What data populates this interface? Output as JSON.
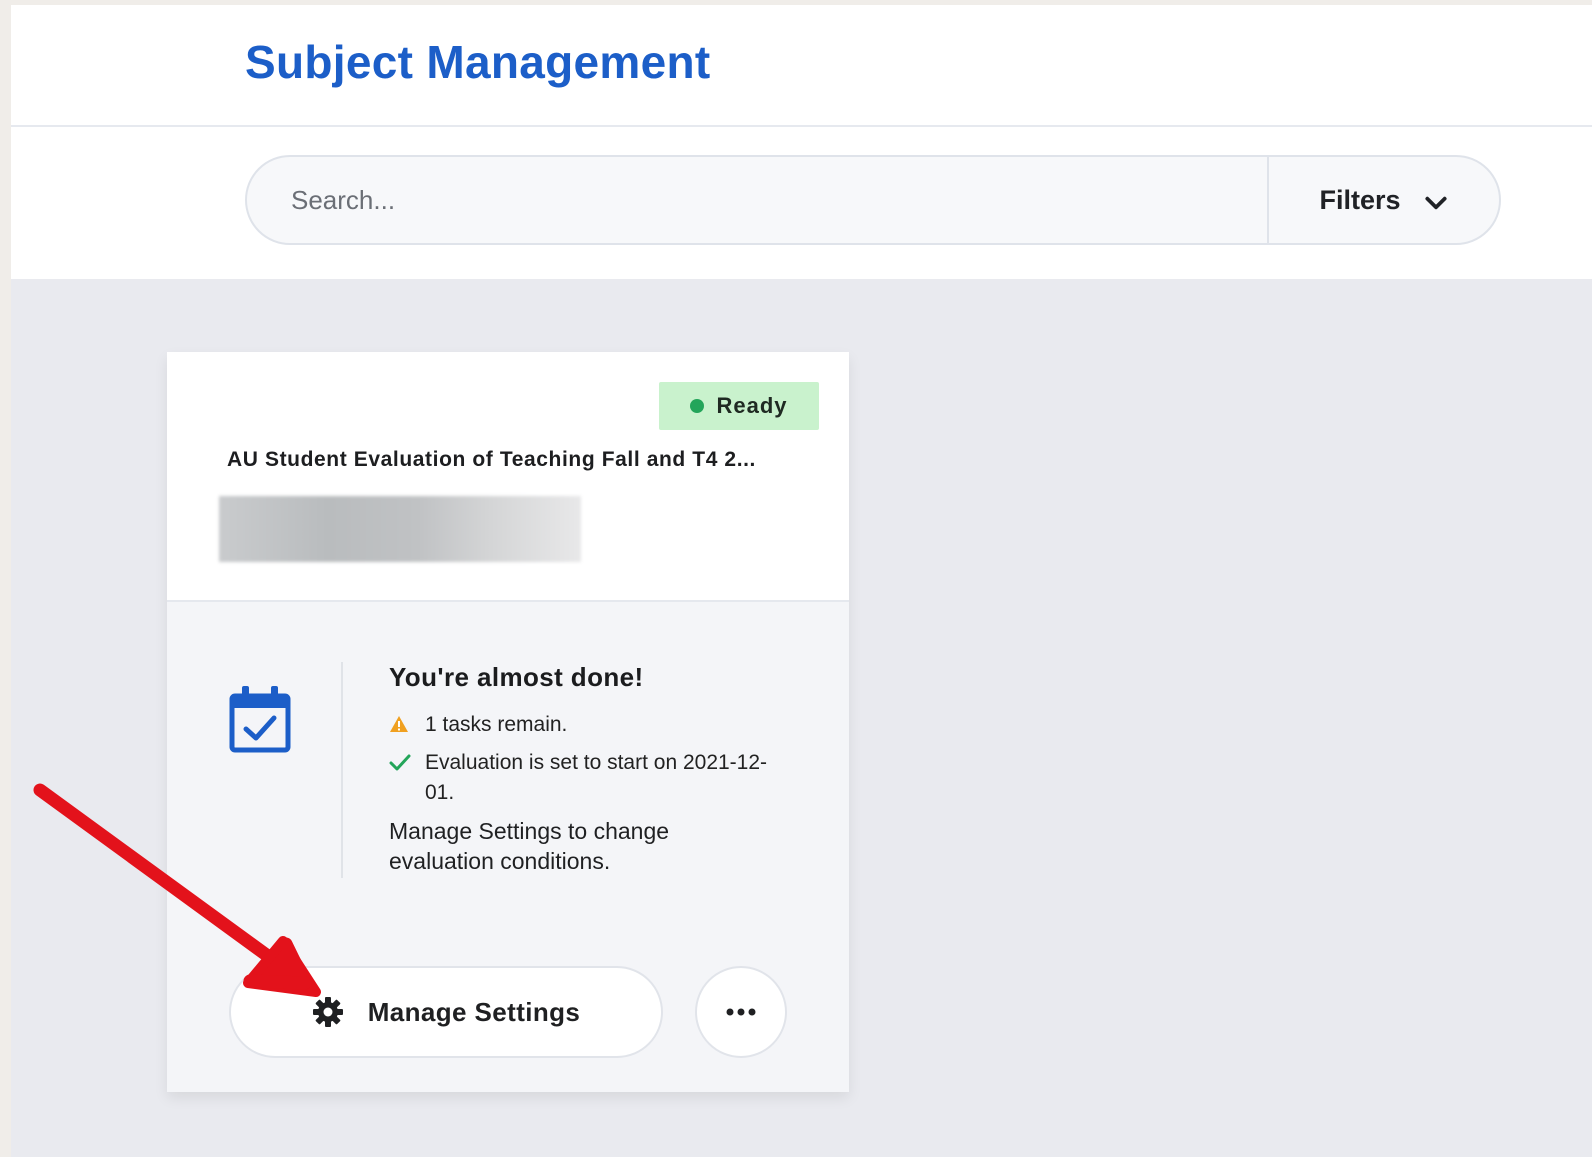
{
  "header": {
    "title": "Subject Management"
  },
  "search": {
    "placeholder": "Search...",
    "filters_label": "Filters"
  },
  "card": {
    "status": "Ready",
    "status_color": "#23a55a",
    "title": "AU Student Evaluation of Teaching Fall and T4 2...",
    "progress_title": "You're almost done!",
    "tasks": [
      {
        "icon": "warning-icon",
        "text": "1 tasks remain."
      },
      {
        "icon": "check-icon",
        "text": "Evaluation is set to start on 2021-12-01."
      }
    ],
    "note": "Manage Settings to change evaluation conditions.",
    "manage_settings_label": "Manage Settings",
    "more_icon": "more-options-icon"
  },
  "colors": {
    "accent": "#1c5ec8",
    "annotation_arrow": "#e3121b",
    "warning": "#f0a020",
    "check": "#23a55a"
  }
}
